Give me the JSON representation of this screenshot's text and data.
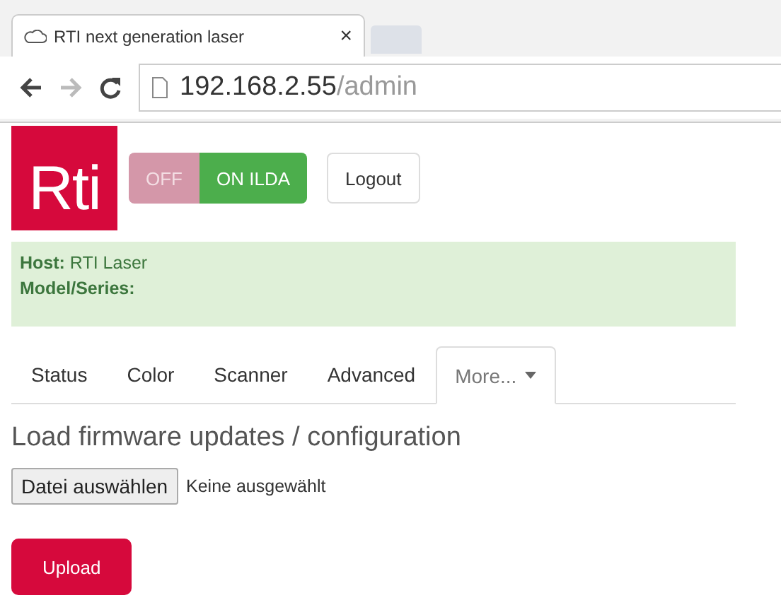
{
  "browser": {
    "tab_title": "RTI next generation laser",
    "close": "×",
    "url_host": "192.168.2.55",
    "url_path": "/admin"
  },
  "header": {
    "logo": "Rti",
    "modes": [
      {
        "label": "OFF",
        "selected": false
      },
      {
        "label": "ON ILDA",
        "selected": true
      }
    ],
    "logout": "Logout"
  },
  "info": [
    {
      "label": "Host:",
      "value": "RTI Laser"
    },
    {
      "label": "Model/Series:"
    }
  ],
  "tabs": [
    {
      "label": "Status",
      "selected": false
    },
    {
      "label": "Color",
      "selected": false
    },
    {
      "label": "Scanner",
      "selected": false
    },
    {
      "label": "Advanced",
      "selected": false
    },
    {
      "label": "More...",
      "selected": true,
      "dropdown": true
    }
  ],
  "heading": "Load firmware updates / configuration",
  "file": {
    "button": "Datei auswählen",
    "status": "Keine ausgewählt"
  },
  "upload": "Upload"
}
